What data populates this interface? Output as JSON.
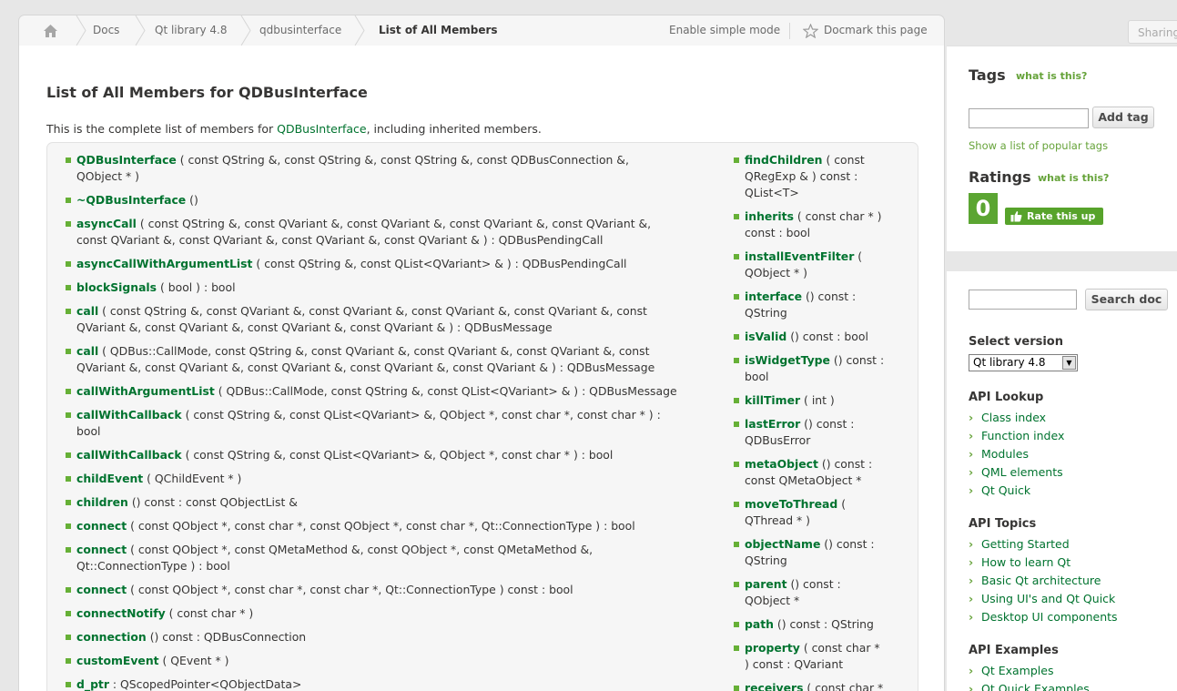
{
  "breadcrumb": {
    "items": [
      "Docs",
      "Qt library 4.8",
      "qdbusinterface",
      "List of All Members"
    ],
    "enable_simple_mode": "Enable simple mode",
    "docmark": "Docmark this page"
  },
  "page": {
    "title": "List of All Members for QDBusInterface",
    "intro_pre": "This is the complete list of members for ",
    "intro_link": "QDBusInterface",
    "intro_post": ", including inherited members."
  },
  "members_left": [
    {
      "name": "QDBusInterface",
      "sig1": " ( const QString &, const QString &, const QString &, const QDBusConnection &,",
      "sig2": "QObject * )"
    },
    {
      "name": "~QDBusInterface",
      "sig1": " ()",
      "sig2": ""
    },
    {
      "name": "asyncCall",
      "sig1": " ( const QString &, const QVariant &, const QVariant &, const QVariant &, const QVariant &,",
      "sig2": "const QVariant &, const QVariant &, const QVariant &, const QVariant & ) : QDBusPendingCall"
    },
    {
      "name": "asyncCallWithArgumentList",
      "sig1": " ( const QString &, const QList<QVariant> & ) : QDBusPendingCall",
      "sig2": ""
    },
    {
      "name": "blockSignals",
      "sig1": " ( bool ) : bool",
      "sig2": ""
    },
    {
      "name": "call",
      "sig1": " ( const QString &, const QVariant &, const QVariant &, const QVariant &, const QVariant &, const",
      "sig2": "QVariant &, const QVariant &, const QVariant &, const QVariant & ) : QDBusMessage"
    },
    {
      "name": "call",
      "sig1": " ( QDBus::CallMode, const QString &, const QVariant &, const QVariant &, const QVariant &, const",
      "sig2": "QVariant &, const QVariant &, const QVariant &, const QVariant &, const QVariant & ) : QDBusMessage"
    },
    {
      "name": "callWithArgumentList",
      "sig1": " ( QDBus::CallMode, const QString &, const QList<QVariant> & ) : QDBusMessage",
      "sig2": ""
    },
    {
      "name": "callWithCallback",
      "sig1": " ( const QString &, const QList<QVariant> &, QObject *, const char *, const char * ) :",
      "sig2": "bool"
    },
    {
      "name": "callWithCallback",
      "sig1": " ( const QString &, const QList<QVariant> &, QObject *, const char * ) : bool",
      "sig2": ""
    },
    {
      "name": "childEvent",
      "sig1": " ( QChildEvent * )",
      "sig2": ""
    },
    {
      "name": "children",
      "sig1": " () const : const QObjectList &",
      "sig2": ""
    },
    {
      "name": "connect",
      "sig1": " ( const QObject *, const char *, const QObject *, const char *, Qt::ConnectionType ) : bool",
      "sig2": ""
    },
    {
      "name": "connect",
      "sig1": " ( const QObject *, const QMetaMethod &, const QObject *, const QMetaMethod &,",
      "sig2": "Qt::ConnectionType ) : bool"
    },
    {
      "name": "connect",
      "sig1": " ( const QObject *, const char *, const char *, Qt::ConnectionType ) const : bool",
      "sig2": ""
    },
    {
      "name": "connectNotify",
      "sig1": " ( const char * )",
      "sig2": ""
    },
    {
      "name": "connection",
      "sig1": " () const : QDBusConnection",
      "sig2": ""
    },
    {
      "name": "customEvent",
      "sig1": " ( QEvent * )",
      "sig2": ""
    },
    {
      "name": "d_ptr",
      "sig1": " : QScopedPointer<QObjectData>",
      "sig2": ""
    }
  ],
  "members_right": [
    {
      "name": "findChildren",
      "sig1": " ( const",
      "sig2": "QRegExp & ) const :",
      "sig3": "QList<T>"
    },
    {
      "name": "inherits",
      "sig1": " ( const char * )",
      "sig2": "const : bool",
      "sig3": ""
    },
    {
      "name": "installEventFilter",
      "sig1": " (",
      "sig2": "QObject * )",
      "sig3": ""
    },
    {
      "name": "interface",
      "sig1": " () const :",
      "sig2": "QString",
      "sig3": ""
    },
    {
      "name": "isValid",
      "sig1": " () const : bool",
      "sig2": "",
      "sig3": ""
    },
    {
      "name": "isWidgetType",
      "sig1": " () const :",
      "sig2": "bool",
      "sig3": ""
    },
    {
      "name": "killTimer",
      "sig1": " ( int )",
      "sig2": "",
      "sig3": ""
    },
    {
      "name": "lastError",
      "sig1": " () const :",
      "sig2": "QDBusError",
      "sig3": ""
    },
    {
      "name": "metaObject",
      "sig1": " () const :",
      "sig2": "const QMetaObject *",
      "sig3": ""
    },
    {
      "name": "moveToThread",
      "sig1": " (",
      "sig2": "QThread * )",
      "sig3": ""
    },
    {
      "name": "objectName",
      "sig1": " () const :",
      "sig2": "QString",
      "sig3": ""
    },
    {
      "name": "parent",
      "sig1": " () const :",
      "sig2": "QObject *",
      "sig3": ""
    },
    {
      "name": "path",
      "sig1": " () const : QString",
      "sig2": "",
      "sig3": ""
    },
    {
      "name": "property",
      "sig1": " ( const char *",
      "sig2": ") const : QVariant",
      "sig3": ""
    },
    {
      "name": "receivers",
      "sig1": " ( const char *",
      "sig2": "",
      "sig3": ""
    }
  ],
  "sidebar": {
    "sharing": "Sharing",
    "tags_title": "Tags",
    "what_is_this": "what is this?",
    "add_tag": "Add tag",
    "popular_tags": "Show a list of popular tags",
    "ratings_title": "Ratings",
    "score": "0",
    "rate_this_up": "Rate this up",
    "search_doc": "Search doc",
    "select_version": "Select version",
    "version_value": "Qt library 4.8",
    "api_lookup": "API Lookup",
    "api_lookup_links": [
      "Class index",
      "Function index",
      "Modules",
      "QML elements",
      "Qt Quick"
    ],
    "api_topics": "API Topics",
    "api_topics_links": [
      "Getting Started",
      "How to learn Qt",
      "Basic Qt architecture",
      "Using UI's and Qt Quick",
      "Desktop UI components"
    ],
    "api_examples": "API Examples",
    "api_examples_links": [
      "Qt Examples",
      "Qt Quick Examples"
    ]
  },
  "colors": {
    "accent_green": "#00732f",
    "link_green": "#66a33a",
    "bullet_green": "#66b036",
    "score_green": "#5ba532"
  }
}
